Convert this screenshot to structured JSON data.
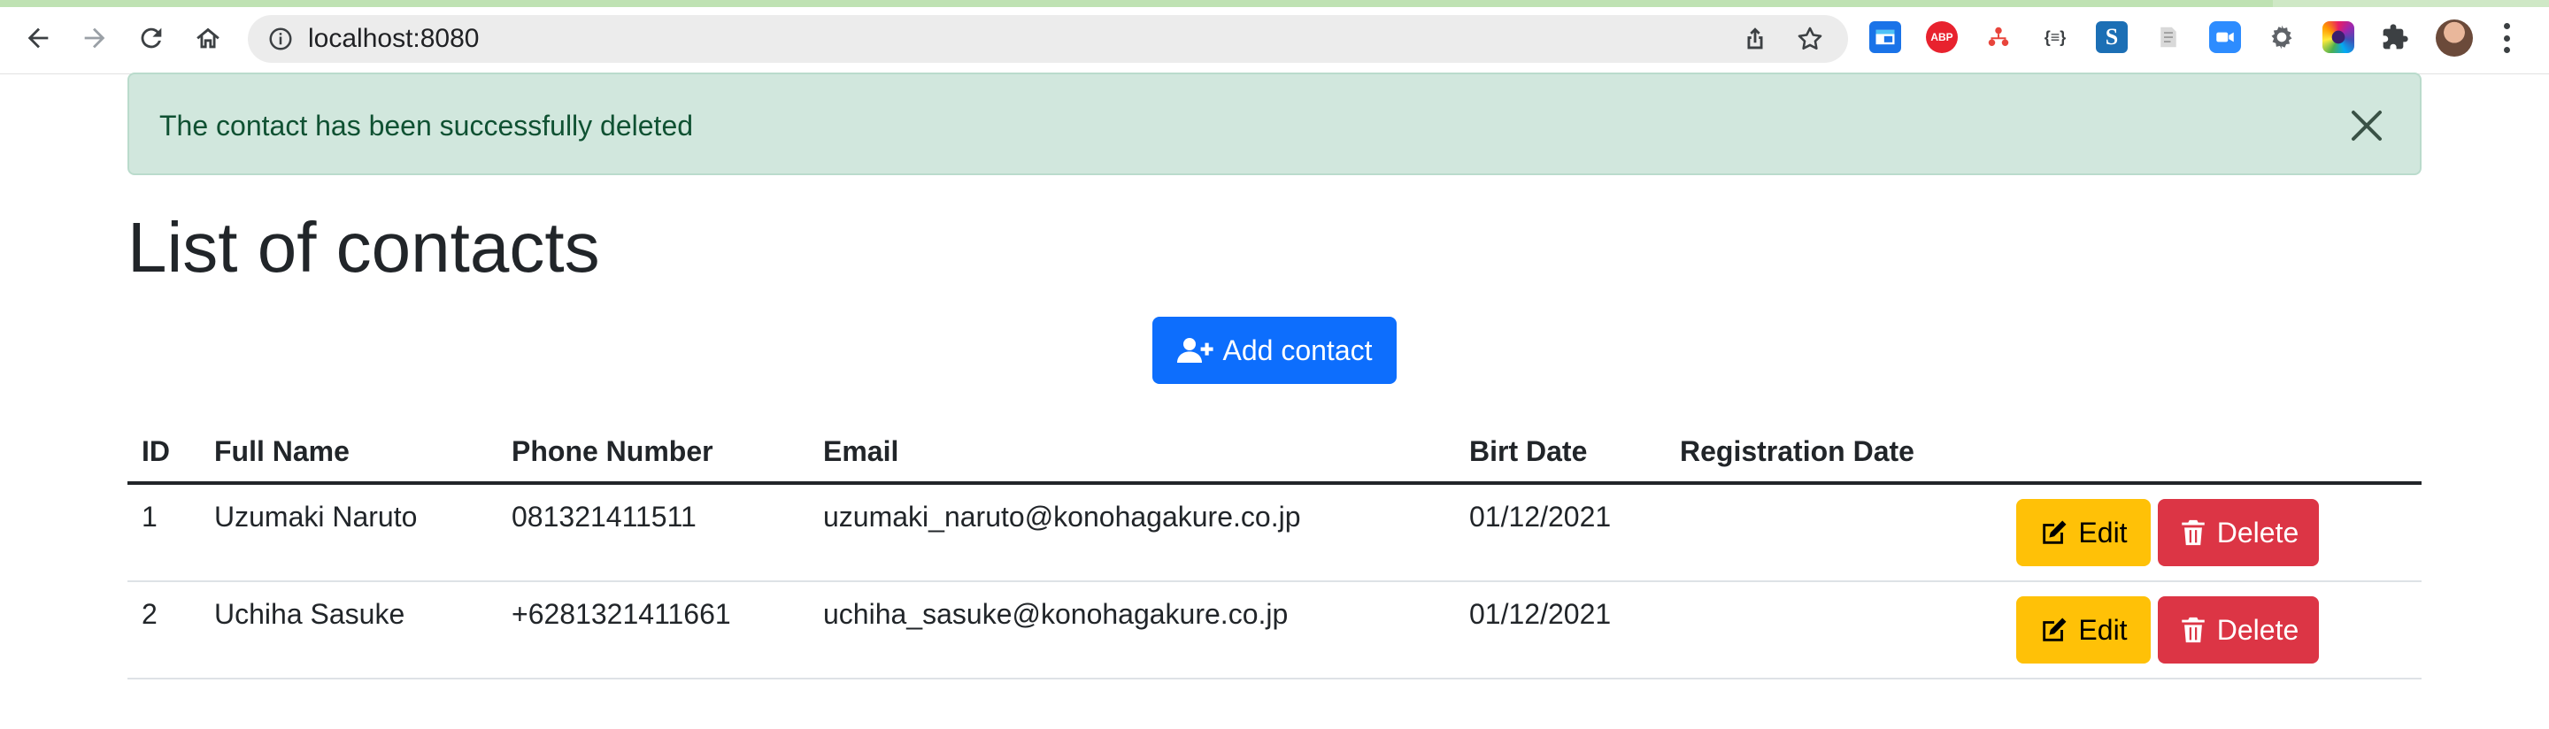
{
  "browser": {
    "url": "localhost:8080",
    "extensions": [
      "generic-extension-icon",
      "adblock-plus-icon",
      "org-chart-extension-icon",
      "json-formatter-icon",
      "s-extension-icon",
      "document-extension-icon",
      "video-call-extension-icon",
      "gear-extension-icon",
      "color-picker-extension-icon",
      "extensions-puzzle-icon"
    ]
  },
  "alert": {
    "message": "The contact has been successfully deleted"
  },
  "page": {
    "title": "List of contacts",
    "add_button": "Add contact"
  },
  "table": {
    "headers": [
      "ID",
      "Full Name",
      "Phone Number",
      "Email",
      "Birt Date",
      "Registration Date"
    ],
    "rows": [
      {
        "id": "1",
        "full_name": "Uzumaki Naruto",
        "phone": "081321411511",
        "email": "uzumaki_naruto@konohagakure.co.jp",
        "birth_date": "01/12/2021",
        "registration_date": "",
        "edit": "Edit",
        "delete": "Delete"
      },
      {
        "id": "2",
        "full_name": "Uchiha Sasuke",
        "phone": "+6281321411661",
        "email": "uchiha_sasuke@konohagakure.co.jp",
        "birth_date": "01/12/2021",
        "registration_date": "",
        "edit": "Edit",
        "delete": "Delete"
      }
    ]
  },
  "colors": {
    "primary": "#0d6efd",
    "warning": "#ffc107",
    "danger": "#dc3545",
    "success_bg": "#d1e7dd",
    "success_text": "#0f5132"
  }
}
